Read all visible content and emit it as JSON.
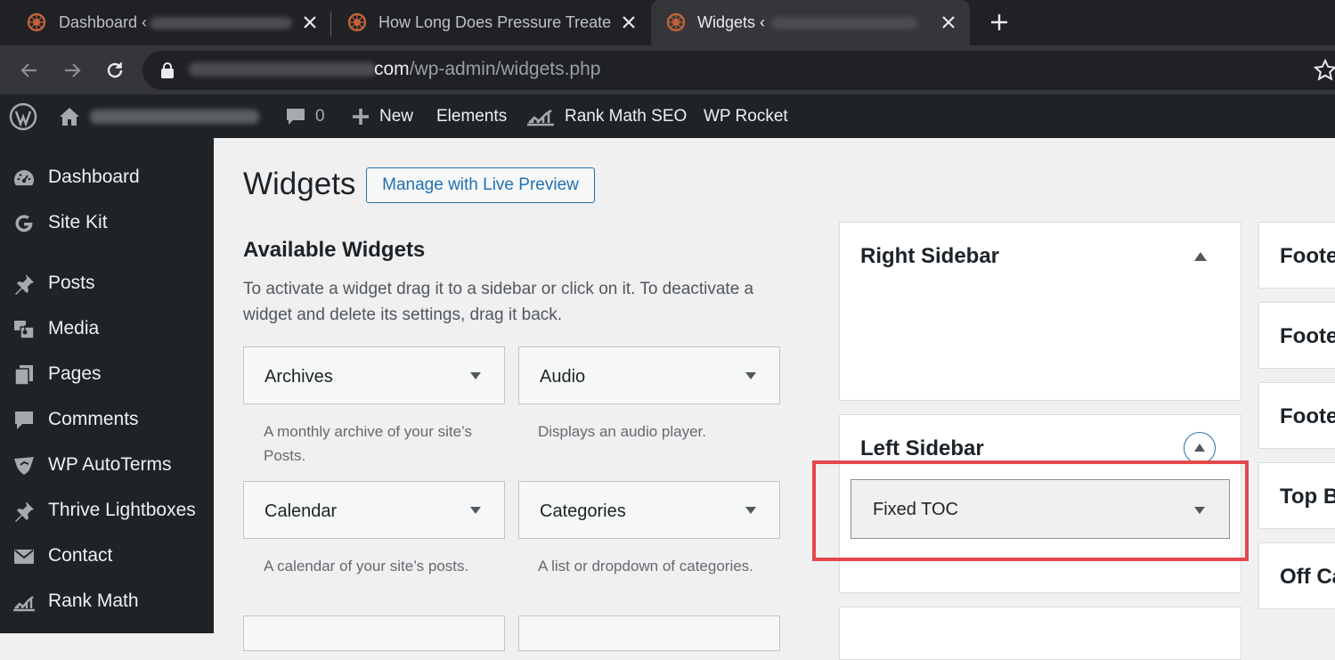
{
  "browser": {
    "tabs": [
      {
        "title": "Dashboard ‹",
        "active": false
      },
      {
        "title": "How Long Does Pressure Treated",
        "active": false
      },
      {
        "title": "Widgets ‹",
        "active": true
      }
    ],
    "url_host": "com",
    "url_path": "/wp-admin/widgets.php"
  },
  "adminbar": {
    "comments_count": "0",
    "new_label": "New",
    "elements_label": "Elements",
    "rankmath_label": "Rank Math SEO",
    "wprocket_label": "WP Rocket"
  },
  "sidebar": {
    "items": [
      {
        "label": "Dashboard",
        "icon": "dashboard-icon"
      },
      {
        "label": "Site Kit",
        "icon": "google-g-icon"
      },
      {
        "label": "Posts",
        "icon": "pin-icon"
      },
      {
        "label": "Media",
        "icon": "media-icon"
      },
      {
        "label": "Pages",
        "icon": "pages-icon"
      },
      {
        "label": "Comments",
        "icon": "comment-icon"
      },
      {
        "label": "WP AutoTerms",
        "icon": "shield-icon"
      },
      {
        "label": "Thrive Lightboxes",
        "icon": "pin-icon"
      },
      {
        "label": "Contact",
        "icon": "mail-icon"
      },
      {
        "label": "Rank Math",
        "icon": "rankmath-icon"
      }
    ]
  },
  "main": {
    "title": "Widgets",
    "live_preview_button": "Manage with Live Preview",
    "available_title": "Available Widgets",
    "available_desc": "To activate a widget drag it to a sidebar or click on it. To deactivate a widget and delete its settings, drag it back.",
    "widgets": [
      {
        "title": "Archives",
        "desc": "A monthly archive of your site’s Posts."
      },
      {
        "title": "Audio",
        "desc": "Displays an audio player."
      },
      {
        "title": "Calendar",
        "desc": "A calendar of your site’s posts."
      },
      {
        "title": "Categories",
        "desc": "A list or dropdown of categories."
      }
    ],
    "right_sidebar_title": "Right Sidebar",
    "left_sidebar_title": "Left Sidebar",
    "left_sidebar_widget": "Fixed TOC",
    "footer_boxes": [
      "Foote",
      "Foote",
      "Foote",
      "Top B",
      "Off Ca"
    ]
  },
  "colors": {
    "accent": "#2271b1",
    "highlight": "#e5474c",
    "admin_dark": "#1d2327"
  }
}
